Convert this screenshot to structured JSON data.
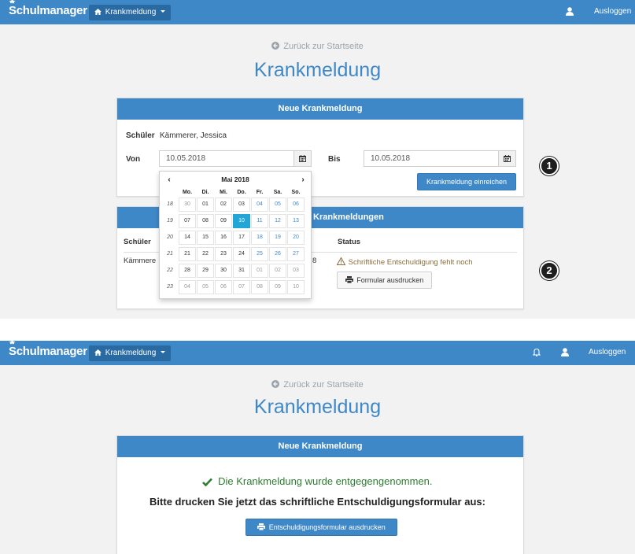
{
  "colors": {
    "brand": "#3f88c8",
    "success": "#2e7d32",
    "warning": "#8a6d3b",
    "selected_day": "#23a6d5"
  },
  "screen1": {
    "navbar": {
      "brand": "Schulmanager",
      "menu_label": "Krankmeldung",
      "logout_label": "Ausloggen"
    },
    "back_link": "Zurück zur Startseite",
    "title": "Krankmeldung",
    "new_panel": {
      "header": "Neue Krankmeldung",
      "student_label": "Schüler",
      "student_value": "Kämmerer, Jessica",
      "from_label": "Von",
      "from_value": "10.05.2018",
      "to_label": "Bis",
      "to_value": "10.05.2018",
      "submit_label": "Krankmeldung einreichen"
    },
    "list_panel": {
      "header_fragment": "Krankmeldungen",
      "col_student": "Schüler",
      "col_status": "Status",
      "row_student_fragment": "Kämmere",
      "row_date_fragment": "8",
      "warning_text": "Schriftliche Entschuldigung fehlt noch",
      "print_form_label": "Formular ausdrucken"
    },
    "datepicker": {
      "month_title": "Mai 2018",
      "prev_icon": "chevron-left-icon",
      "next_icon": "chevron-right-icon",
      "weekdays": [
        "Mo.",
        "Di.",
        "Mi.",
        "Do.",
        "Fr.",
        "Sa.",
        "So."
      ],
      "weeks": [
        {
          "num": "18",
          "days": [
            "30",
            "01",
            "02",
            "03",
            "04",
            "05",
            "06"
          ]
        },
        {
          "num": "19",
          "days": [
            "07",
            "08",
            "09",
            "10",
            "11",
            "12",
            "13"
          ]
        },
        {
          "num": "20",
          "days": [
            "14",
            "15",
            "16",
            "17",
            "18",
            "19",
            "20"
          ]
        },
        {
          "num": "21",
          "days": [
            "21",
            "22",
            "23",
            "24",
            "25",
            "26",
            "27"
          ]
        },
        {
          "num": "22",
          "days": [
            "28",
            "29",
            "30",
            "31",
            "01",
            "02",
            "03"
          ]
        },
        {
          "num": "23",
          "days": [
            "04",
            "05",
            "06",
            "07",
            "08",
            "09",
            "10"
          ]
        }
      ],
      "selected": "10"
    },
    "badges": [
      "1",
      "2"
    ]
  },
  "screen2": {
    "navbar": {
      "brand": "Schulmanager",
      "menu_label": "Krankmeldung",
      "logout_label": "Ausloggen"
    },
    "back_link": "Zurück zur Startseite",
    "title": "Krankmeldung",
    "panel_header": "Neue Krankmeldung",
    "success_message": "Die Krankmeldung wurde entgegengenommen.",
    "print_prompt": "Bitte drucken Sie jetzt das schriftliche Entschuldigungsformular aus:",
    "print_button_label": "Entschuldigungsformular ausdrucken"
  }
}
